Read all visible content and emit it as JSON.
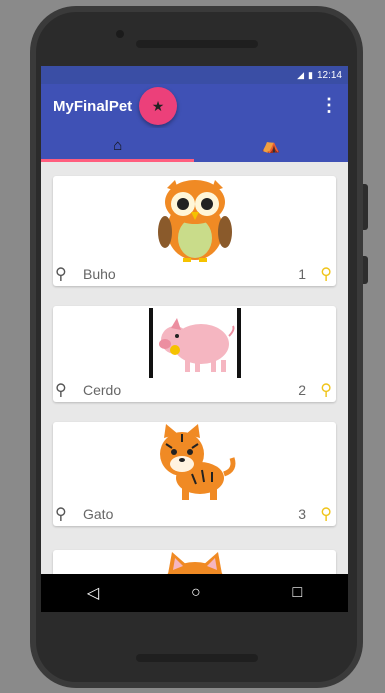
{
  "status_bar": {
    "time": "12:14",
    "signal_icon": "signal-icon",
    "battery_icon": "battery-icon"
  },
  "app_bar": {
    "title": "MyFinalPet",
    "fab_icon": "star-icon",
    "menu_icon": "overflow-menu-icon",
    "menu_glyph": "⋮"
  },
  "tabs": [
    {
      "icon": "home-icon",
      "glyph": "⌂"
    },
    {
      "icon": "doghouse-icon",
      "glyph": "⛺"
    }
  ],
  "pets": [
    {
      "name": "Buho",
      "count": "1",
      "image": "owl-image"
    },
    {
      "name": "Cerdo",
      "count": "2",
      "image": "pig-image"
    },
    {
      "name": "Gato",
      "count": "3",
      "image": "tiger-image"
    },
    {
      "name": "",
      "count": "",
      "image": "cat-image"
    }
  ],
  "nav": {
    "back": "◁",
    "home": "○",
    "recents": "□"
  },
  "colors": {
    "primary": "#3f51b5",
    "accent": "#ec407a",
    "bone": "#f0c419"
  }
}
